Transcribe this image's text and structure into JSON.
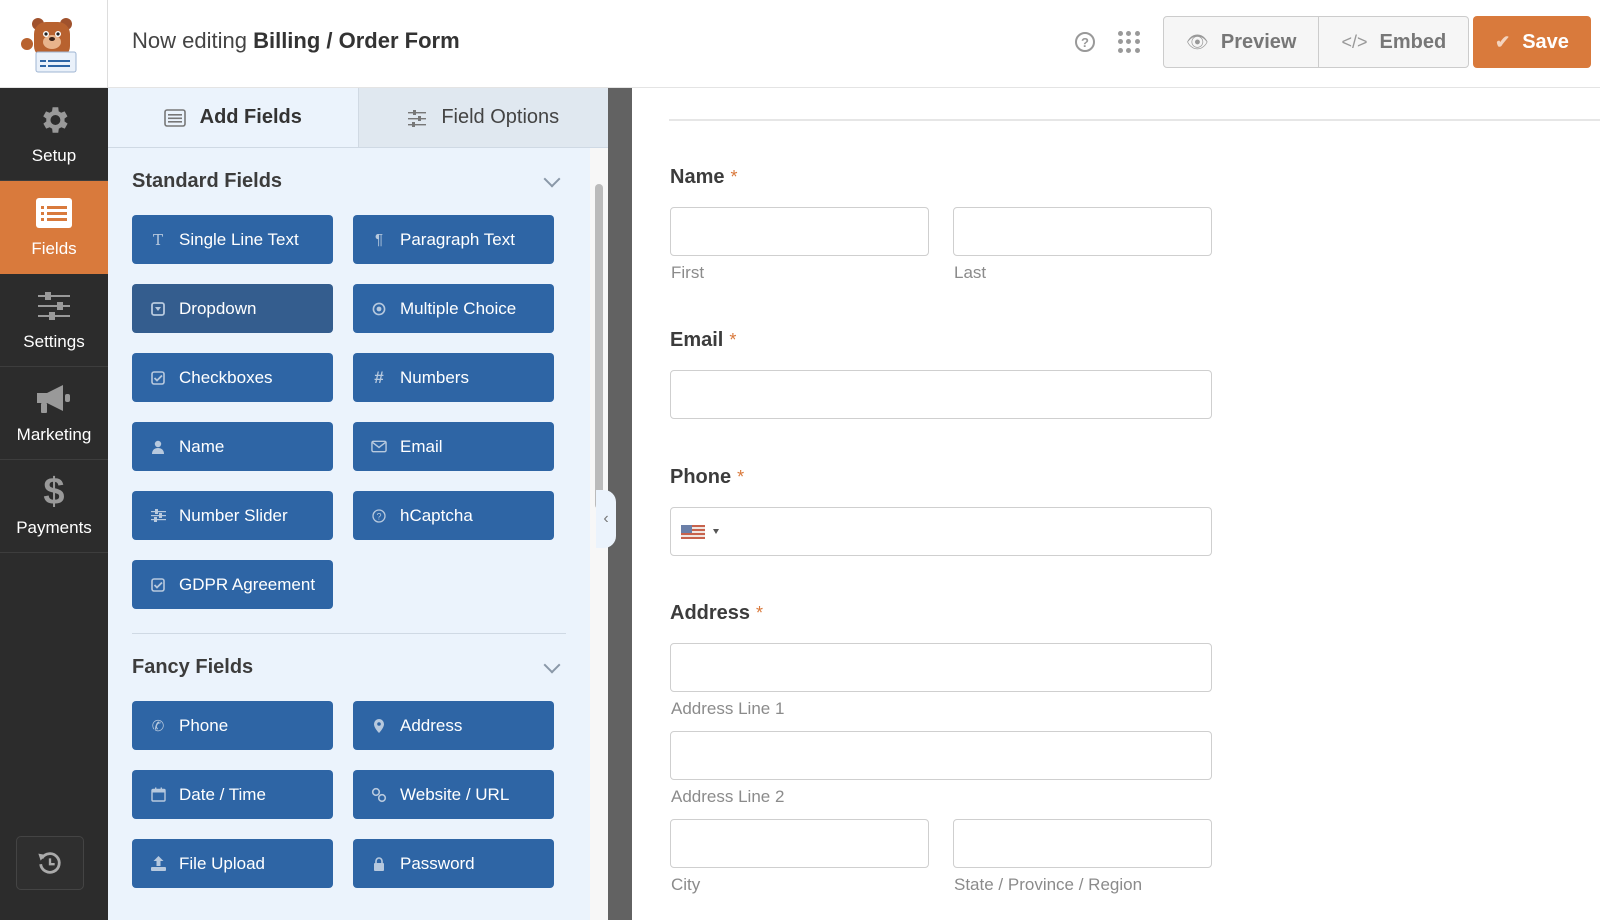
{
  "header": {
    "title_prefix": "Now editing",
    "form_name": "Billing / Order Form",
    "help_icon": "question-circle-icon",
    "apps_icon": "grid-dots-icon",
    "preview_label": "Preview",
    "embed_label": "Embed",
    "save_label": "Save",
    "brand_color": "#d97a3c"
  },
  "leftnav": {
    "items": [
      {
        "label": "Setup",
        "icon": "gear-icon",
        "active": false
      },
      {
        "label": "Fields",
        "icon": "fields-list-icon",
        "active": true
      },
      {
        "label": "Settings",
        "icon": "sliders-icon",
        "active": false
      },
      {
        "label": "Marketing",
        "icon": "megaphone-icon",
        "active": false
      },
      {
        "label": "Payments",
        "icon": "dollar-icon",
        "active": false
      }
    ],
    "history_icon": "revisions-history-icon"
  },
  "panel": {
    "tabs": [
      {
        "label": "Add Fields",
        "icon": "list-icon",
        "active": true
      },
      {
        "label": "Field Options",
        "icon": "sliders-icon",
        "active": false
      }
    ],
    "sections": [
      {
        "title": "Standard Fields",
        "fields": [
          {
            "label": "Single Line Text",
            "icon": "text-cursor-icon"
          },
          {
            "label": "Paragraph Text",
            "icon": "paragraph-icon"
          },
          {
            "label": "Dropdown",
            "icon": "dropdown-icon"
          },
          {
            "label": "Multiple Choice",
            "icon": "radio-icon"
          },
          {
            "label": "Checkboxes",
            "icon": "checkbox-icon"
          },
          {
            "label": "Numbers",
            "icon": "hash-icon"
          },
          {
            "label": "Name",
            "icon": "user-icon"
          },
          {
            "label": "Email",
            "icon": "envelope-icon"
          },
          {
            "label": "Number Slider",
            "icon": "sliders-icon"
          },
          {
            "label": "hCaptcha",
            "icon": "question-circle-icon"
          },
          {
            "label": "GDPR Agreement",
            "icon": "checkbox-icon"
          }
        ]
      },
      {
        "title": "Fancy Fields",
        "fields": [
          {
            "label": "Phone",
            "icon": "phone-icon"
          },
          {
            "label": "Address",
            "icon": "map-marker-icon"
          },
          {
            "label": "Date / Time",
            "icon": "calendar-icon"
          },
          {
            "label": "Website / URL",
            "icon": "link-icon"
          },
          {
            "label": "File Upload",
            "icon": "upload-icon"
          },
          {
            "label": "Password",
            "icon": "lock-icon"
          }
        ]
      }
    ]
  },
  "form": {
    "required_marker": "*",
    "name": {
      "label": "Name",
      "first": "First",
      "last": "Last",
      "first_value": "",
      "last_value": ""
    },
    "email": {
      "label": "Email",
      "value": ""
    },
    "phone": {
      "label": "Phone",
      "country": "US",
      "value": ""
    },
    "address": {
      "label": "Address",
      "line1": "Address Line 1",
      "line2": "Address Line 2",
      "city": "City",
      "state": "State / Province / Region"
    }
  }
}
